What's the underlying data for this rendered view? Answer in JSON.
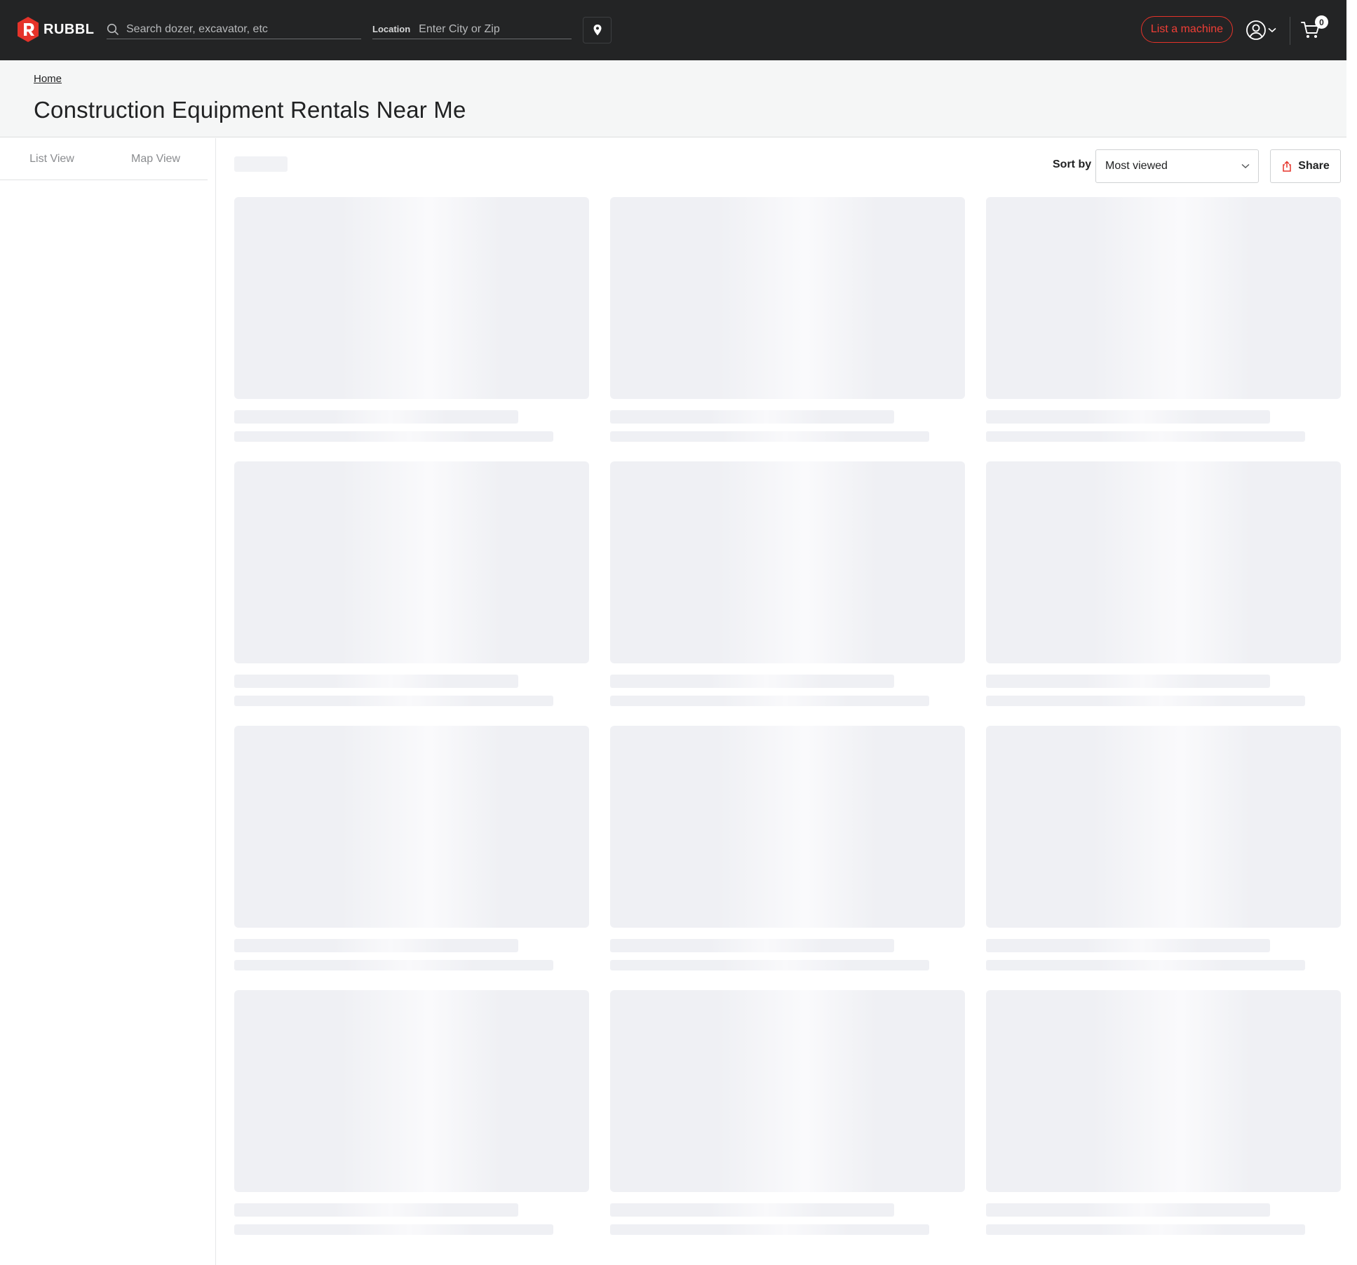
{
  "header": {
    "brand": "RUBBL",
    "search_placeholder": "Search dozer, excavator, etc",
    "location_label": "Location",
    "location_placeholder": "Enter City or Zip",
    "list_machine_label": "List a machine",
    "cart_count": "0",
    "colors": {
      "background": "#232425",
      "accent": "#e5332a"
    }
  },
  "breadcrumb": {
    "home": "Home"
  },
  "page_title": "Construction Equipment Rentals Near Me",
  "view_tabs": [
    {
      "label": "List View"
    },
    {
      "label": "Map View"
    }
  ],
  "toolbar": {
    "sort_label": "Sort by",
    "sort_value": "Most viewed",
    "share_label": "Share"
  },
  "listing_placeholders": {
    "count": 12,
    "state": "loading"
  }
}
